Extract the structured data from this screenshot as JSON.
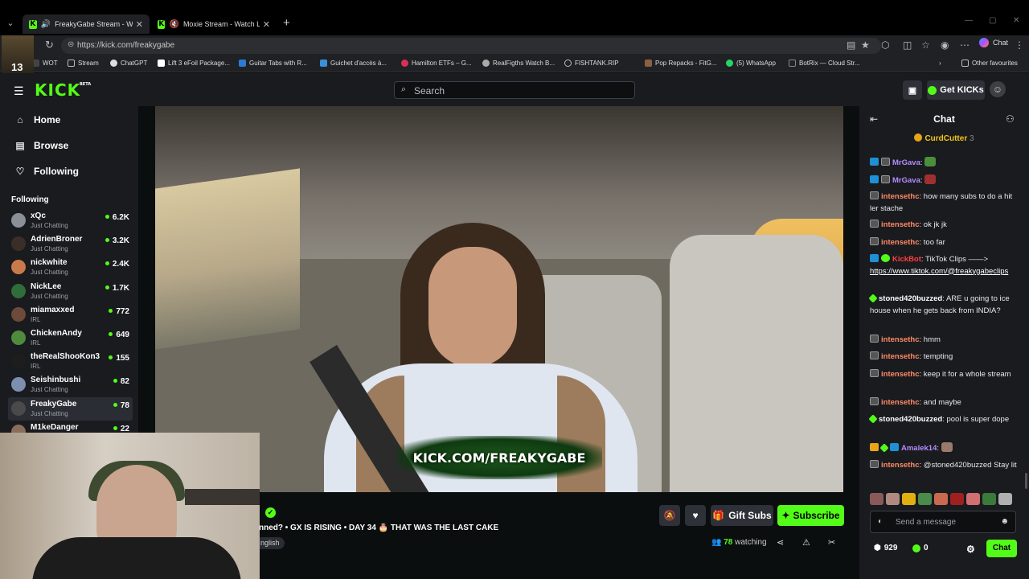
{
  "browser": {
    "tabs": [
      {
        "title": "FreakyGabe Stream - Watch Live on Kick",
        "active": true,
        "muted": false
      },
      {
        "title": "Moxie Stream - Watch Live on Kick",
        "active": false,
        "muted": true
      }
    ],
    "new_tab": "+",
    "url": "https://kick.com/freakygabe",
    "copilot_label": "Chat",
    "bookmarks": [
      "WOT",
      "Stream",
      "ChatGPT",
      "Lift 3 eFoil Package...",
      "Guitar Tabs with R...",
      "Guichet d'accès à...",
      "Hamilton ETFs – G...",
      "RealFigths Watch B...",
      "FISHTANK.RIP",
      "Pop Repacks - FitG...",
      "(5) WhatsApp",
      "BotRix — Cloud Str..."
    ],
    "other_favourites": "Other favourites",
    "cam_number": "13"
  },
  "header": {
    "logo": "KICK",
    "logo_beta": "BETA",
    "search_placeholder": "Search",
    "get_kicks": "Get KICKs"
  },
  "sidebar": {
    "nav": [
      {
        "label": "Home",
        "icon": "home-icon"
      },
      {
        "label": "Browse",
        "icon": "browse-icon"
      },
      {
        "label": "Following",
        "icon": "heart-icon"
      }
    ],
    "following_title": "Following",
    "channels": [
      {
        "name": "xQc",
        "category": "Just Chatting",
        "viewers": "6.2K",
        "color": "#8a8f98"
      },
      {
        "name": "AdrienBroner",
        "category": "Just Chatting",
        "viewers": "3.2K",
        "color": "#3b2e28"
      },
      {
        "name": "nickwhite",
        "category": "Just Chatting",
        "viewers": "2.4K",
        "color": "#c97a4a"
      },
      {
        "name": "NickLee",
        "category": "Just Chatting",
        "viewers": "1.7K",
        "color": "#2f6d3a"
      },
      {
        "name": "miamaxxed",
        "category": "IRL",
        "viewers": "772",
        "color": "#6e4a3a"
      },
      {
        "name": "ChickenAndy",
        "category": "IRL",
        "viewers": "649",
        "color": "#4e8b3d"
      },
      {
        "name": "theRealShooKon3",
        "category": "IRL",
        "viewers": "155",
        "color": "#1d1d1d"
      },
      {
        "name": "Seishinbushi",
        "category": "Just Chatting",
        "viewers": "82",
        "color": "#7d8fb0"
      },
      {
        "name": "FreakyGabe",
        "category": "Just Chatting",
        "viewers": "78",
        "color": "#4a4a4a",
        "selected": true
      },
      {
        "name": "M1keDanger",
        "category": "",
        "viewers": "22",
        "color": "#8a6d5a"
      }
    ]
  },
  "stream": {
    "overlay_text": "KICK.COM/FREAKYGABE",
    "title": "nned? • GX IS RISING • DAY 34 🎂 THAT WAS THE LAST CAKE",
    "language": "nglish",
    "gift_subs": "Gift Subs",
    "subscribe": "Subscribe",
    "viewer_count": "78",
    "watching_label": "watching"
  },
  "chat": {
    "title": "Chat",
    "pinned_user": "CurdCutter",
    "pinned_count": "3",
    "messages": [
      {
        "badges": [
          "sub",
          "mod"
        ],
        "user": "MrGava",
        "color": "#b58cff",
        "text": "",
        "emote": "#4a8f3a"
      },
      {
        "badges": [
          "sub",
          "mod"
        ],
        "user": "MrGava",
        "color": "#b58cff",
        "text": "",
        "emote": "#a03030"
      },
      {
        "badges": [
          "mod"
        ],
        "user": "intensethc",
        "color": "#ff8a65",
        "text": "how many subs to do a hit ler stache"
      },
      {
        "badges": [
          "mod"
        ],
        "user": "intensethc",
        "color": "#ff8a65",
        "text": "ok jk jk"
      },
      {
        "badges": [
          "mod"
        ],
        "user": "intensethc",
        "color": "#ff8a65",
        "text": "too far"
      },
      {
        "badges": [
          "sub",
          "ver"
        ],
        "user": "KickBot",
        "color": "#ff4040",
        "text": "TikTok Clips ——> ",
        "link": "https://www.tiktok.com/@freakygabeclips"
      },
      {
        "badges": [
          "og"
        ],
        "user": "stoned420buzzed",
        "color": "#ffffff",
        "text": "ARE u going to ice house when he gets back from INDIA?"
      },
      {
        "badges": [
          "mod"
        ],
        "user": "intensethc",
        "color": "#ff8a65",
        "text": "hmm"
      },
      {
        "badges": [
          "mod"
        ],
        "user": "intensethc",
        "color": "#ff8a65",
        "text": "tempting"
      },
      {
        "badges": [
          "mod"
        ],
        "user": "intensethc",
        "color": "#ff8a65",
        "text": "keep it for a whole stream"
      },
      {
        "badges": [
          "mod"
        ],
        "user": "intensethc",
        "color": "#ff8a65",
        "text": "and maybe"
      },
      {
        "badges": [
          "og"
        ],
        "user": "stoned420buzzed",
        "color": "#ffffff",
        "text": "pool is super dope"
      },
      {
        "badges": [
          "gift",
          "og",
          "sub"
        ],
        "user": "Amalek14",
        "color": "#b58cff",
        "text": "",
        "emote": "#9a7a6a"
      },
      {
        "badges": [
          "mod"
        ],
        "user": "intensethc",
        "color": "#ff8a65",
        "text": "@stoned420buzzed Stay lit"
      }
    ],
    "input_placeholder": "Send a message",
    "points": "929",
    "kicks": "0",
    "chat_button": "Chat"
  }
}
